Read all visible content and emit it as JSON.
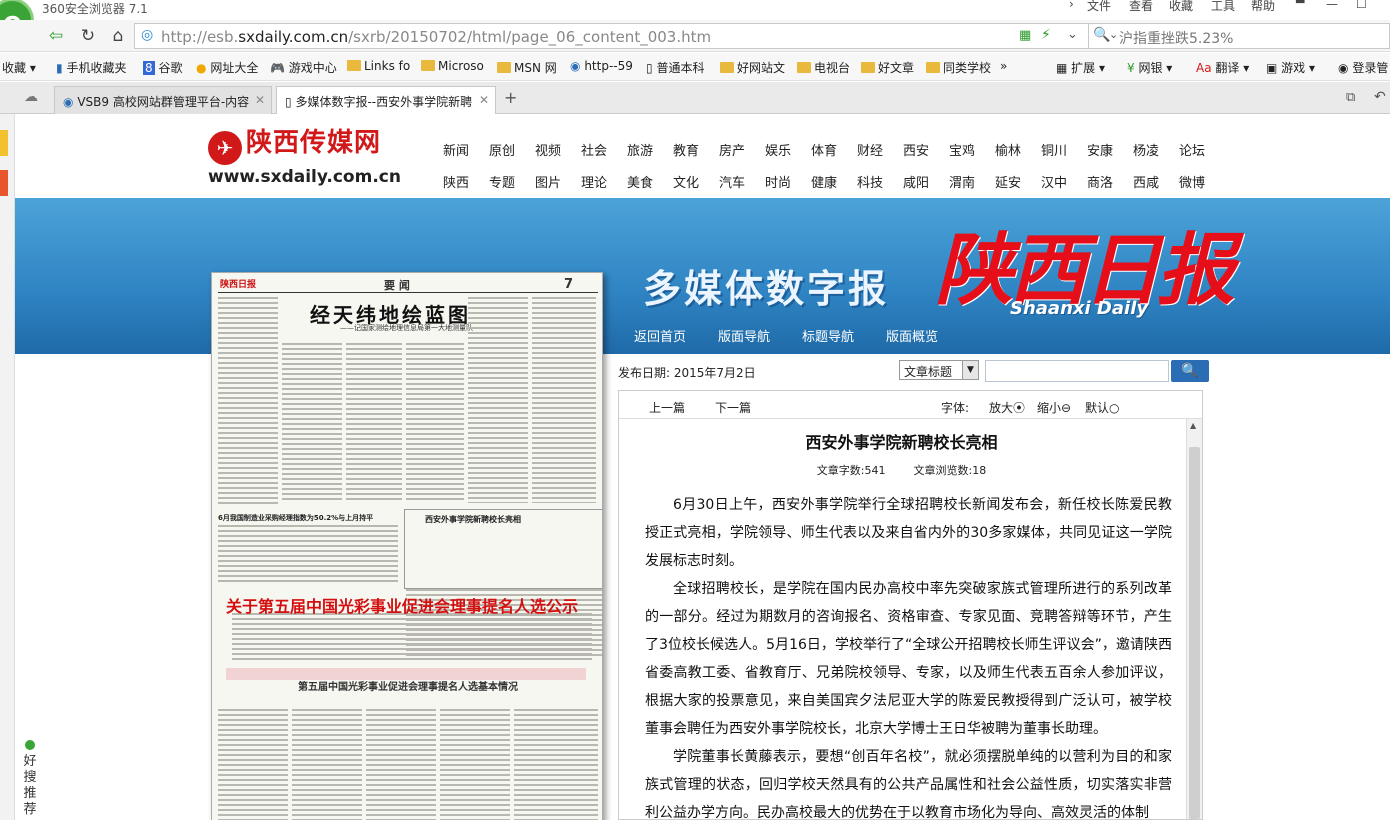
{
  "browser": {
    "app_title": "360安全浏览器 7.1",
    "menu": [
      "文件",
      "查看",
      "收藏",
      "工具",
      "帮助"
    ],
    "url_prefix": "http://esb.",
    "url_domain": "sxdaily.com.cn",
    "url_path": "/sxrb/20150702/html/page_06_content_003.htm",
    "search_text": "沪指重挫跌5.23%",
    "bookmarks": [
      "收藏",
      "手机收藏夹",
      "谷歌",
      "网址大全",
      "游戏中心",
      "Links fo",
      "Microso",
      "MSN 网",
      "http--59",
      "普通本科",
      "好网站文",
      "电视台",
      "好文章",
      "同类学校",
      "扩展",
      "网银",
      "翻译",
      "游戏",
      "登录管"
    ],
    "tabs": [
      {
        "label": "VSB9 高校网站群管理平台-内容"
      },
      {
        "label": "多媒体数字报--西安外事学院新聘"
      }
    ],
    "new_tab": "+"
  },
  "site": {
    "logo_text": "陕西传媒网",
    "logo_url": "www.sxdaily.com.cn",
    "nav_row1": [
      "新闻",
      "原创",
      "视频",
      "社会",
      "旅游",
      "教育",
      "房产",
      "娱乐",
      "体育",
      "财经",
      "西安",
      "宝鸡",
      "榆林",
      "铜川",
      "安康",
      "杨凌",
      "论坛"
    ],
    "nav_row2": [
      "陕西",
      "专题",
      "图片",
      "理论",
      "美食",
      "文化",
      "汽车",
      "时尚",
      "健康",
      "科技",
      "咸阳",
      "渭南",
      "延安",
      "汉中",
      "商洛",
      "西咸",
      "微博"
    ]
  },
  "banner": {
    "title": "多媒体数字报",
    "paper_name": "陕西日报",
    "paper_name_en": "Shaanxi Daily",
    "nav": [
      "返回首页",
      "版面导航",
      "标题导航",
      "版面概览"
    ]
  },
  "thumbnail": {
    "brand": "陕西日报",
    "section": "要 闻",
    "page_no": "7",
    "headline": "经天纬地绘蓝图",
    "subhead": "——记国家测绘地理信息局第一大地测量队",
    "left_headline": "6月我国制造业采购经理指数为50.2%与上月持平",
    "side_box_title": "西安外事学院新聘校长亮相",
    "notice_title": "关于第五届中国光彩事业促进会理事提名人选公示",
    "notice_sub": "第五届中国光彩事业促进会理事提名人选基本情况"
  },
  "search": {
    "date_label": "发布日期:",
    "date_value": "2015年7月2日",
    "select_value": "文章标题",
    "query_value": "",
    "button_icon": "search-icon"
  },
  "article": {
    "prev": "上一篇",
    "next": "下一篇",
    "font_label": "字体:",
    "font_larger": "放大",
    "font_smaller": "缩小",
    "font_default": "默认",
    "title": "西安外事学院新聘校长亮相",
    "word_count_label": "文章字数:",
    "word_count": "541",
    "view_count_label": "文章浏览数:",
    "view_count": "18",
    "paragraphs": [
      "6月30日上午，西安外事学院举行全球招聘校长新闻发布会，新任校长陈爱民教授正式亮相，学院领导、师生代表以及来自省内外的30多家媒体，共同见证这一学院发展标志时刻。",
      "全球招聘校长，是学院在国内民办高校中率先突破家族式管理所进行的系列改革的一部分。经过为期数月的咨询报名、资格审查、专家见面、竞聘答辩等环节，产生了3位校长候选人。5月16日，学校举行了“全球公开招聘校长师生评议会”，邀请陕西省委高教工委、省教育厅、兄弟院校领导、专家，以及师生代表五百余人参加评议，根据大家的投票意见，来自美国宾夕法尼亚大学的陈爱民教授得到广泛认可，被学校董事会聘任为西安外事学院校长，北京大学博士王日华被聘为董事长助理。",
      "学院董事长黄藤表示，要想“创百年名校”，就必须摆脱单纯的以营利为目的和家族式管理的状态，回归学校天然具有的公共产品属性和社会公益性质，切实落实非营利公益办学方向。民办高校最大的优势在于以教育市场化为导向、高效灵活的体制"
    ]
  },
  "sidebar": {
    "label": "好搜推荐"
  }
}
